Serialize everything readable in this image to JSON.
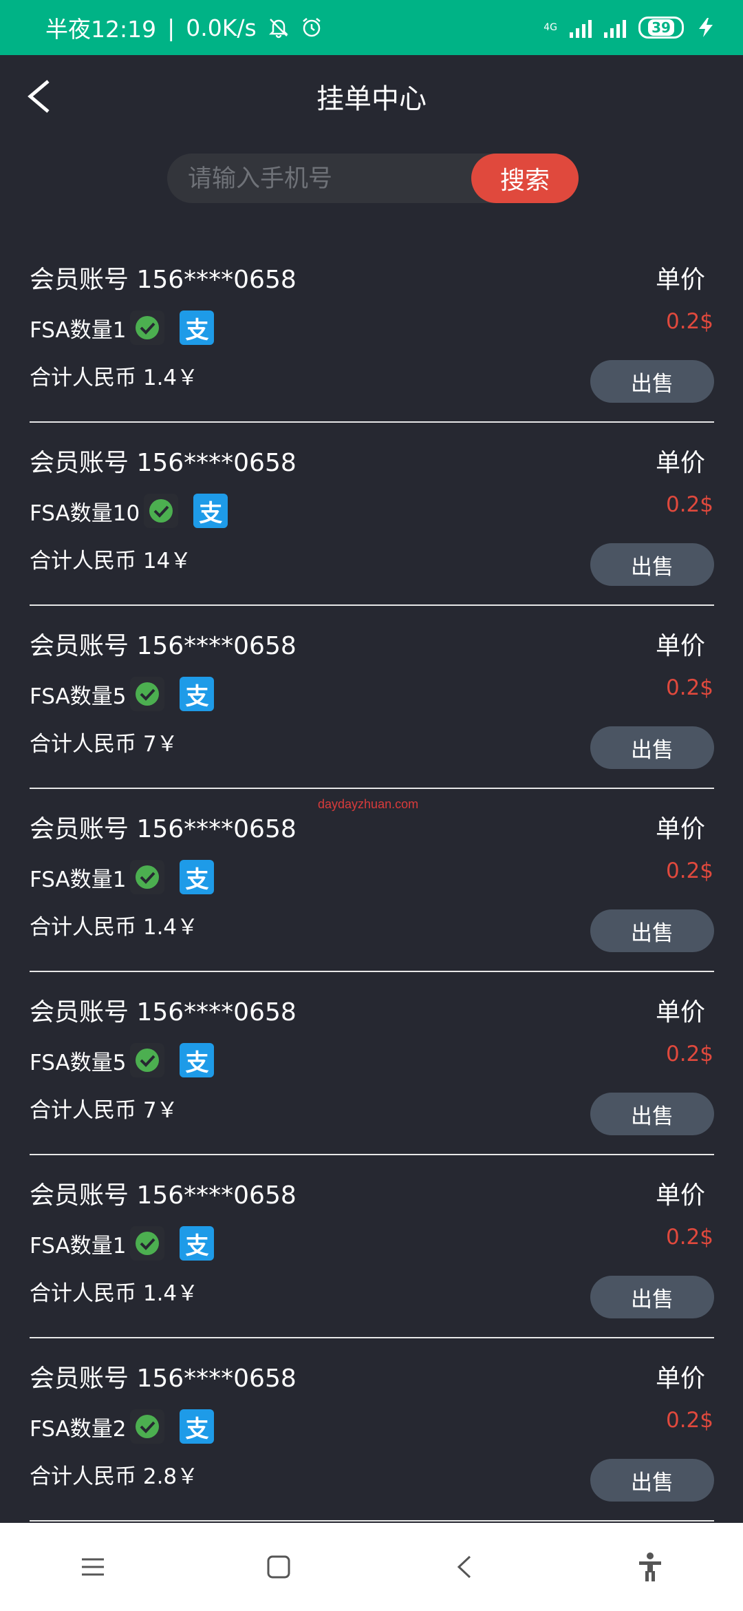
{
  "status_bar": {
    "time": "半夜12:19",
    "network_speed": "0.0K/s",
    "network_type": "4G",
    "battery": "39",
    "icons": [
      "bell-off-icon",
      "alarm-icon",
      "signal-icon",
      "charging-icon"
    ]
  },
  "header": {
    "title": "挂单中心"
  },
  "search": {
    "placeholder": "请输入手机号",
    "button_label": "搜索"
  },
  "orders": [
    {
      "account": "会员账号 156****0658",
      "price_label": "单价",
      "quantity": "FSA数量1",
      "price": "0.2$",
      "total": "合计人民币 1.4￥",
      "sell_label": "出售"
    },
    {
      "account": "会员账号 156****0658",
      "price_label": "单价",
      "quantity": "FSA数量10",
      "price": "0.2$",
      "total": "合计人民币 14￥",
      "sell_label": "出售"
    },
    {
      "account": "会员账号 156****0658",
      "price_label": "单价",
      "quantity": "FSA数量5",
      "price": "0.2$",
      "total": "合计人民币 7￥",
      "sell_label": "出售"
    },
    {
      "account": "会员账号 156****0658",
      "price_label": "单价",
      "quantity": "FSA数量1",
      "price": "0.2$",
      "total": "合计人民币 1.4￥",
      "sell_label": "出售"
    },
    {
      "account": "会员账号 156****0658",
      "price_label": "单价",
      "quantity": "FSA数量5",
      "price": "0.2$",
      "total": "合计人民币 7￥",
      "sell_label": "出售"
    },
    {
      "account": "会员账号 156****0658",
      "price_label": "单价",
      "quantity": "FSA数量1",
      "price": "0.2$",
      "total": "合计人民币 1.4￥",
      "sell_label": "出售"
    },
    {
      "account": "会员账号 156****0658",
      "price_label": "单价",
      "quantity": "FSA数量2",
      "price": "0.2$",
      "total": "合计人民币 2.8￥",
      "sell_label": "出售"
    }
  ],
  "watermark": "daydayzhuan.com",
  "colors": {
    "status_bar": "#00b386",
    "background": "#262831",
    "accent": "#e0493d",
    "sell_button": "#4b5563",
    "alipay": "#1e9be8",
    "wechat": "#4caf50"
  }
}
